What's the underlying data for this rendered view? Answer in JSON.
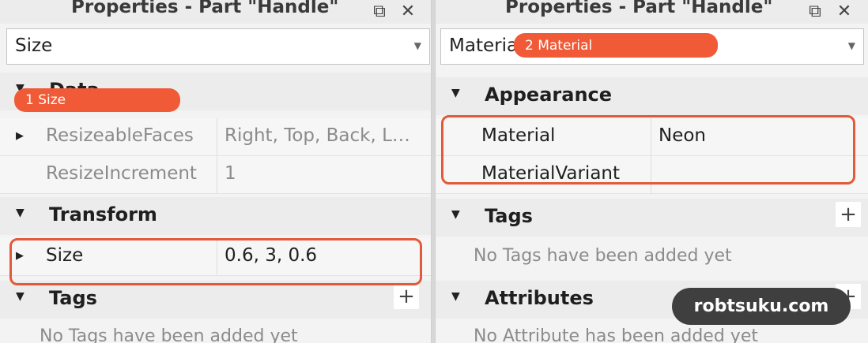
{
  "left_panel": {
    "title": "Properties - Part \"Handle\"",
    "filter": "Size",
    "partial_section": "Data",
    "rows_top": [
      {
        "name": "ResizeableFaces",
        "value": "Right, Top, Back, L…",
        "expander": "▶"
      },
      {
        "name": "ResizeIncrement",
        "value": "1",
        "expander": ""
      }
    ],
    "transform_section": "Transform",
    "size_row": {
      "name": "Size",
      "value": "0.6, 3, 0.6",
      "expander": "▶"
    },
    "tags_section": "Tags",
    "tags_empty": "No Tags have been added yet"
  },
  "right_panel": {
    "title": "Properties - Part \"Handle\"",
    "filter": "Material",
    "appearance_section": "Appearance",
    "rows": [
      {
        "name": "Material",
        "value": "Neon"
      },
      {
        "name": "MaterialVariant",
        "value": ""
      }
    ],
    "tags_section": "Tags",
    "tags_empty": "No Tags have been added yet",
    "attributes_section": "Attributes",
    "attributes_empty": "No Attribute has been added yet"
  },
  "icons": {
    "undock": "⧉",
    "close": "✕",
    "dropdown": "▼",
    "collapse": "▼",
    "expand": "▶",
    "add": "+"
  },
  "badges": {
    "size": "1 Size",
    "material": "2 Material"
  },
  "watermark": "robtsuku.com",
  "colors": {
    "highlight": "#e25a3a",
    "badge": "#f05a37",
    "watermark_bg": "#3f3f3f"
  }
}
